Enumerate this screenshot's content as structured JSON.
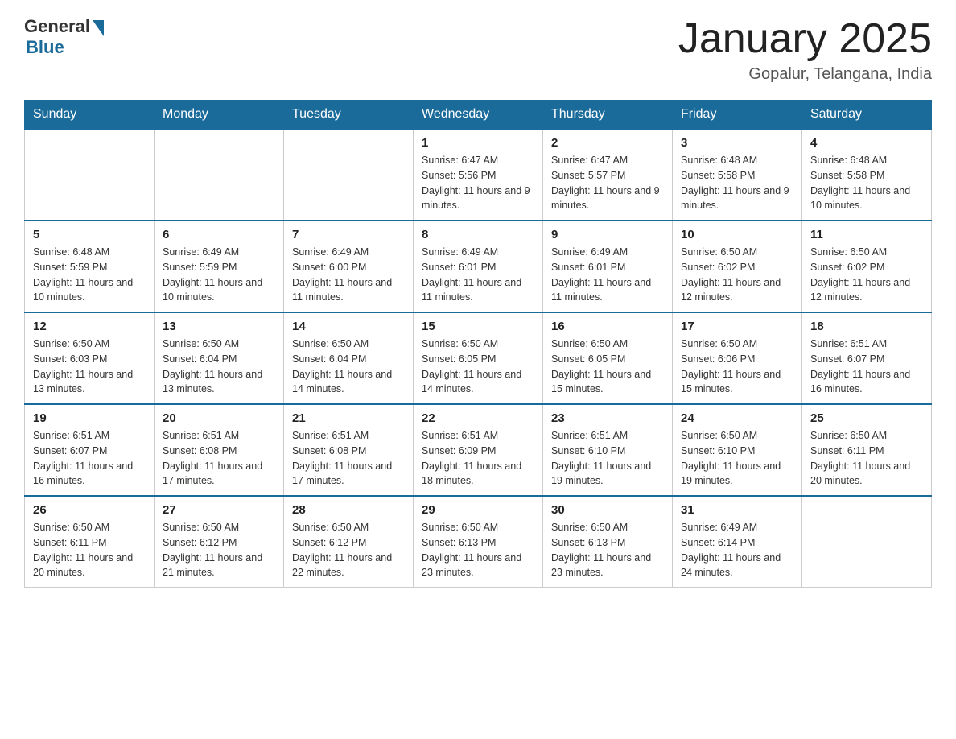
{
  "logo": {
    "general": "General",
    "blue": "Blue"
  },
  "title": "January 2025",
  "location": "Gopalur, Telangana, India",
  "days_of_week": [
    "Sunday",
    "Monday",
    "Tuesday",
    "Wednesday",
    "Thursday",
    "Friday",
    "Saturday"
  ],
  "weeks": [
    [
      {
        "day": "",
        "info": ""
      },
      {
        "day": "",
        "info": ""
      },
      {
        "day": "",
        "info": ""
      },
      {
        "day": "1",
        "info": "Sunrise: 6:47 AM\nSunset: 5:56 PM\nDaylight: 11 hours and 9 minutes."
      },
      {
        "day": "2",
        "info": "Sunrise: 6:47 AM\nSunset: 5:57 PM\nDaylight: 11 hours and 9 minutes."
      },
      {
        "day": "3",
        "info": "Sunrise: 6:48 AM\nSunset: 5:58 PM\nDaylight: 11 hours and 9 minutes."
      },
      {
        "day": "4",
        "info": "Sunrise: 6:48 AM\nSunset: 5:58 PM\nDaylight: 11 hours and 10 minutes."
      }
    ],
    [
      {
        "day": "5",
        "info": "Sunrise: 6:48 AM\nSunset: 5:59 PM\nDaylight: 11 hours and 10 minutes."
      },
      {
        "day": "6",
        "info": "Sunrise: 6:49 AM\nSunset: 5:59 PM\nDaylight: 11 hours and 10 minutes."
      },
      {
        "day": "7",
        "info": "Sunrise: 6:49 AM\nSunset: 6:00 PM\nDaylight: 11 hours and 11 minutes."
      },
      {
        "day": "8",
        "info": "Sunrise: 6:49 AM\nSunset: 6:01 PM\nDaylight: 11 hours and 11 minutes."
      },
      {
        "day": "9",
        "info": "Sunrise: 6:49 AM\nSunset: 6:01 PM\nDaylight: 11 hours and 11 minutes."
      },
      {
        "day": "10",
        "info": "Sunrise: 6:50 AM\nSunset: 6:02 PM\nDaylight: 11 hours and 12 minutes."
      },
      {
        "day": "11",
        "info": "Sunrise: 6:50 AM\nSunset: 6:02 PM\nDaylight: 11 hours and 12 minutes."
      }
    ],
    [
      {
        "day": "12",
        "info": "Sunrise: 6:50 AM\nSunset: 6:03 PM\nDaylight: 11 hours and 13 minutes."
      },
      {
        "day": "13",
        "info": "Sunrise: 6:50 AM\nSunset: 6:04 PM\nDaylight: 11 hours and 13 minutes."
      },
      {
        "day": "14",
        "info": "Sunrise: 6:50 AM\nSunset: 6:04 PM\nDaylight: 11 hours and 14 minutes."
      },
      {
        "day": "15",
        "info": "Sunrise: 6:50 AM\nSunset: 6:05 PM\nDaylight: 11 hours and 14 minutes."
      },
      {
        "day": "16",
        "info": "Sunrise: 6:50 AM\nSunset: 6:05 PM\nDaylight: 11 hours and 15 minutes."
      },
      {
        "day": "17",
        "info": "Sunrise: 6:50 AM\nSunset: 6:06 PM\nDaylight: 11 hours and 15 minutes."
      },
      {
        "day": "18",
        "info": "Sunrise: 6:51 AM\nSunset: 6:07 PM\nDaylight: 11 hours and 16 minutes."
      }
    ],
    [
      {
        "day": "19",
        "info": "Sunrise: 6:51 AM\nSunset: 6:07 PM\nDaylight: 11 hours and 16 minutes."
      },
      {
        "day": "20",
        "info": "Sunrise: 6:51 AM\nSunset: 6:08 PM\nDaylight: 11 hours and 17 minutes."
      },
      {
        "day": "21",
        "info": "Sunrise: 6:51 AM\nSunset: 6:08 PM\nDaylight: 11 hours and 17 minutes."
      },
      {
        "day": "22",
        "info": "Sunrise: 6:51 AM\nSunset: 6:09 PM\nDaylight: 11 hours and 18 minutes."
      },
      {
        "day": "23",
        "info": "Sunrise: 6:51 AM\nSunset: 6:10 PM\nDaylight: 11 hours and 19 minutes."
      },
      {
        "day": "24",
        "info": "Sunrise: 6:50 AM\nSunset: 6:10 PM\nDaylight: 11 hours and 19 minutes."
      },
      {
        "day": "25",
        "info": "Sunrise: 6:50 AM\nSunset: 6:11 PM\nDaylight: 11 hours and 20 minutes."
      }
    ],
    [
      {
        "day": "26",
        "info": "Sunrise: 6:50 AM\nSunset: 6:11 PM\nDaylight: 11 hours and 20 minutes."
      },
      {
        "day": "27",
        "info": "Sunrise: 6:50 AM\nSunset: 6:12 PM\nDaylight: 11 hours and 21 minutes."
      },
      {
        "day": "28",
        "info": "Sunrise: 6:50 AM\nSunset: 6:12 PM\nDaylight: 11 hours and 22 minutes."
      },
      {
        "day": "29",
        "info": "Sunrise: 6:50 AM\nSunset: 6:13 PM\nDaylight: 11 hours and 23 minutes."
      },
      {
        "day": "30",
        "info": "Sunrise: 6:50 AM\nSunset: 6:13 PM\nDaylight: 11 hours and 23 minutes."
      },
      {
        "day": "31",
        "info": "Sunrise: 6:49 AM\nSunset: 6:14 PM\nDaylight: 11 hours and 24 minutes."
      },
      {
        "day": "",
        "info": ""
      }
    ]
  ]
}
